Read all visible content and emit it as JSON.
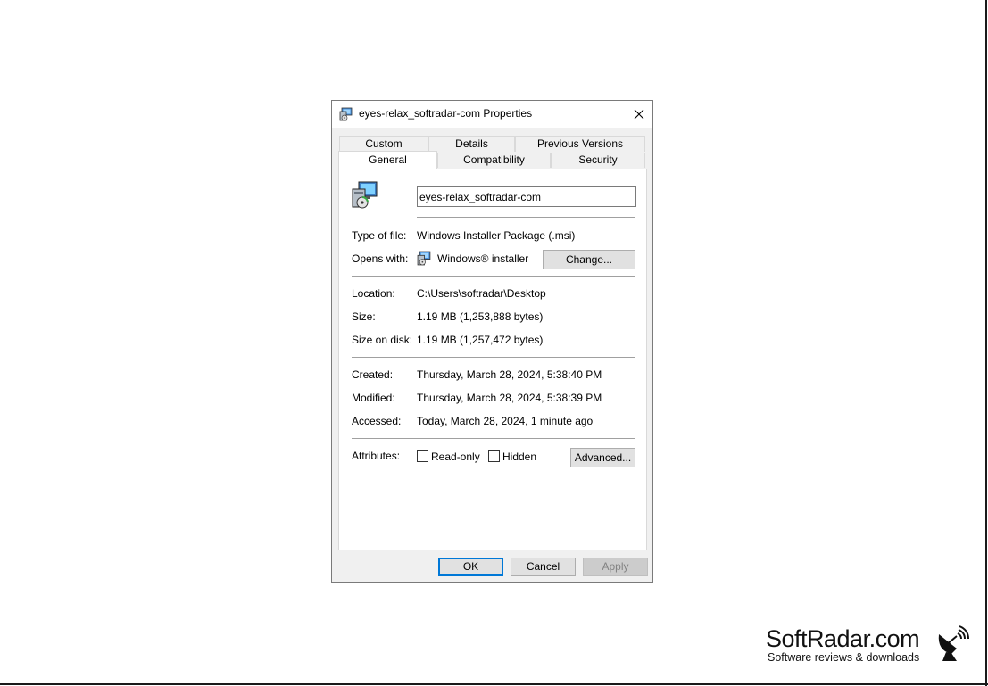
{
  "dialog": {
    "title": "eyes-relax_softradar-com Properties",
    "tabs_top": [
      "Custom",
      "Details",
      "Previous Versions"
    ],
    "tabs_bottom": [
      "General",
      "Compatibility",
      "Security"
    ],
    "active_tab": "General",
    "file_name": "eyes-relax_softradar-com",
    "rows": {
      "type_label": "Type of file:",
      "type_value": "Windows Installer Package (.msi)",
      "opens_label": "Opens with:",
      "opens_value": "Windows® installer",
      "change_button": "Change...",
      "location_label": "Location:",
      "location_value": "C:\\Users\\softradar\\Desktop",
      "size_label": "Size:",
      "size_value": "1.19 MB (1,253,888 bytes)",
      "disk_label": "Size on disk:",
      "disk_value": "1.19 MB (1,257,472 bytes)",
      "created_label": "Created:",
      "created_value": "Thursday, March 28, 2024, 5:38:40 PM",
      "modified_label": "Modified:",
      "modified_value": "Thursday, March 28, 2024, 5:38:39 PM",
      "accessed_label": "Accessed:",
      "accessed_value": "Today, March 28, 2024, 1 minute ago",
      "attributes_label": "Attributes:",
      "readonly_label": "Read-only",
      "hidden_label": "Hidden",
      "advanced_button": "Advanced..."
    },
    "buttons": {
      "ok": "OK",
      "cancel": "Cancel",
      "apply": "Apply"
    }
  },
  "watermark": {
    "title": "SoftRadar.com",
    "subtitle": "Software reviews & downloads"
  },
  "colors": {
    "accent": "#0078d7",
    "dialog_bg": "#f0f0f0"
  }
}
